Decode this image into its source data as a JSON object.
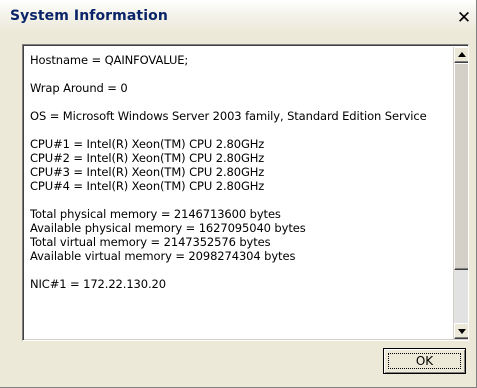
{
  "window": {
    "title": "System Information",
    "close_glyph": "✕"
  },
  "info": {
    "hostname": "Hostname = QAINFOVALUE;",
    "wrap": "Wrap Around = 0",
    "os": "OS = Microsoft Windows Server 2003 family, Standard Edition Service",
    "cpus": [
      "CPU#1 = Intel(R) Xeon(TM) CPU 2.80GHz",
      "CPU#2 = Intel(R) Xeon(TM) CPU 2.80GHz",
      "CPU#3 = Intel(R) Xeon(TM) CPU 2.80GHz",
      "CPU#4 = Intel(R) Xeon(TM) CPU 2.80GHz"
    ],
    "memory": [
      "Total physical memory = 2146713600 bytes",
      "Available physical memory = 1627095040 bytes",
      "Total virtual memory = 2147352576 bytes",
      "Available virtual memory = 2098274304 bytes"
    ],
    "nic": "NIC#1 = 172.22.130.20"
  },
  "buttons": {
    "ok": "OK"
  },
  "icons": {
    "close": "close-icon",
    "scroll_up": "arrow-up-icon",
    "scroll_down": "arrow-down-icon"
  }
}
